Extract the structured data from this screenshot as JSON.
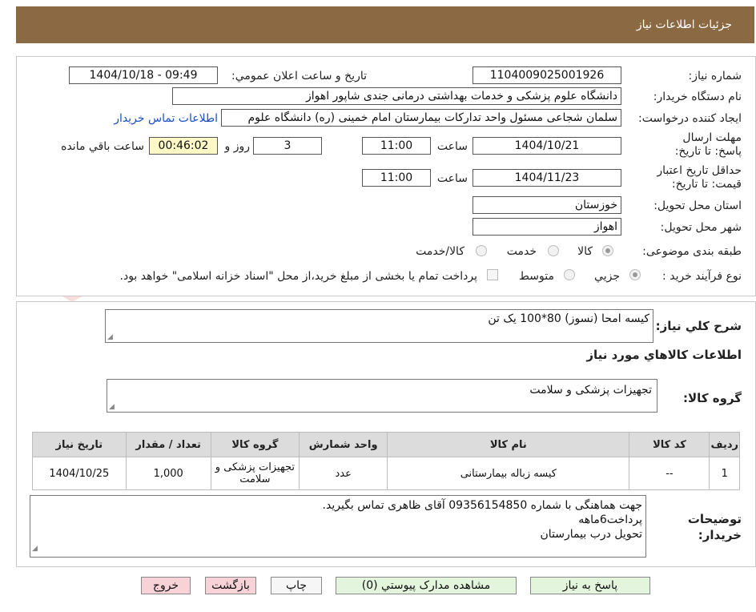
{
  "header": {
    "title": "جزئیات اطلاعات نیاز"
  },
  "watermark": {
    "text": "AriaTender.neT"
  },
  "form": {
    "need_number_label": "شماره نیاز:",
    "need_number": "1104009025001926",
    "announce_label": "تاریخ و ساعت اعلان عمومي:",
    "announce_value": "1404/10/18 - 09:49",
    "buyer_org_label": "نام دستگاه خریدار:",
    "buyer_org": "دانشگاه علوم پزشکی و خدمات بهداشتی درمانی جندی شاپور اهواز",
    "requester_label": "ایجاد کننده درخواست:",
    "requester": "سلمان شجاعی مسئول واحد تدارکات بیمارستان امام خمینی (ره) دانشگاه علوم",
    "contact_link": "اطلاعات تماس خریدار",
    "deadline_label": "مهلت ارسال پاسخ: تا تاریخ:",
    "deadline_date": "1404/10/21",
    "time_label": "ساعت",
    "deadline_time": "11:00",
    "days_value": "3",
    "days_label": "روز و",
    "remaining_time": "00:46:02",
    "remaining_label": "ساعت باقي مانده",
    "validity_label": "حداقل تاریخ اعتبار قیمت: تا تاریخ:",
    "validity_date": "1404/11/23",
    "validity_time": "11:00",
    "province_label": "استان محل تحویل:",
    "province": "خوزستان",
    "city_label": "شهر محل تحویل:",
    "city": "اهواز",
    "category_label": "طبقه بندی موضوعی:",
    "category_options": [
      "کالا",
      "خدمت",
      "کالا/خدمت"
    ],
    "category_selected": "کالا",
    "process_label": "نوع فرآیند خرید :",
    "process_options": [
      "جزیي",
      "متوسط"
    ],
    "process_selected": "جزیي",
    "payment_note": "پرداخت تمام یا بخشی از مبلغ خرید،از محل \"اسناد خزانه اسلامی\" خواهد بود."
  },
  "summary": {
    "label": "شرح کلي نیاز:",
    "text": "کیسه امحا (نسوز) 80*100      یک تن",
    "goods_info_title": "اطلاعات کالاهاي مورد نیاز",
    "group_label": "گروه کالا:",
    "group_value": "تجهیزات پزشکی و سلامت"
  },
  "table": {
    "headers": [
      "ردیف",
      "کد کالا",
      "نام کالا",
      "واحد شمارش",
      "گروه کالا",
      "تعداد / مقدار",
      "تاریخ نیاز"
    ],
    "rows": [
      [
        "1",
        "--",
        "کیسه زباله بیمارستانی",
        "عدد",
        "تجهیزات پزشکی و سلامت",
        "1,000",
        "1404/10/25"
      ]
    ]
  },
  "buyer_notes": {
    "label": "توضیحات خریدار:",
    "lines": [
      "جهت هماهنگی با شماره 09356154850 آقای ظاهری تماس بگیرید.",
      "پرداخت6ماهه",
      "تحویل درب بیمارستان"
    ]
  },
  "buttons": {
    "reply": "پاسخ به نیاز",
    "attachments": "مشاهده مدارک پیوستي (0)",
    "print": "چاپ",
    "back": "بازگشت",
    "exit": "خروج"
  }
}
